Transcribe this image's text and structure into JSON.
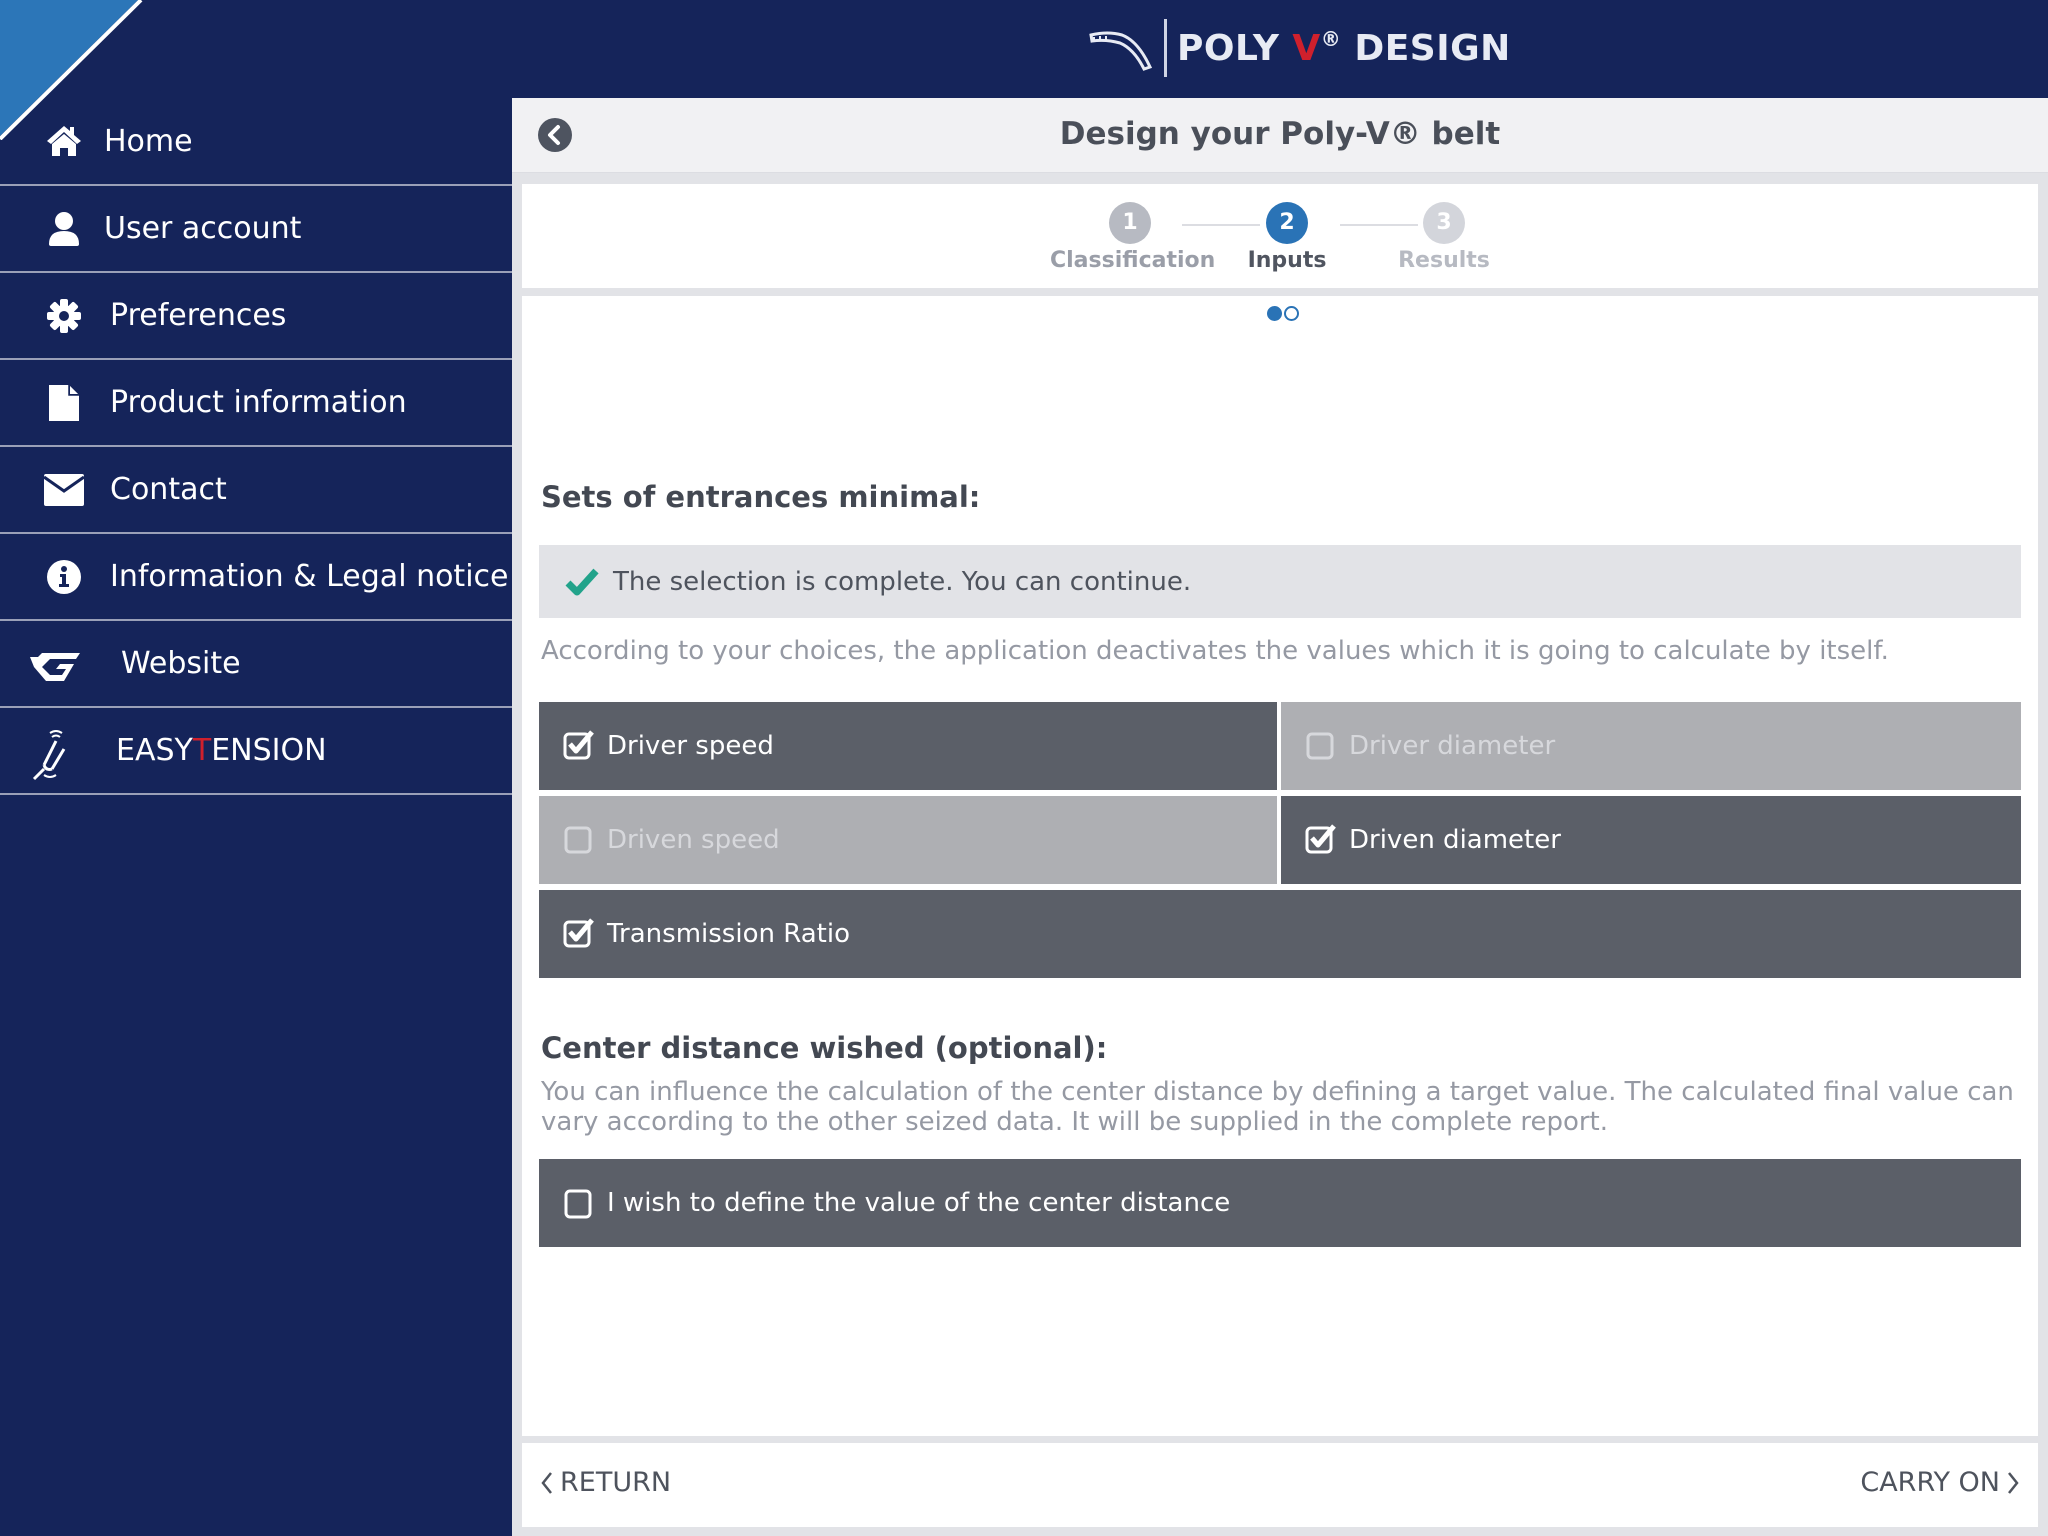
{
  "header": {
    "brand_prefix": "POLY ",
    "brand_v": "V",
    "brand_reg": "®",
    "brand_suffix": " DESIGN",
    "logo_icon": "belt-logo-icon"
  },
  "sidebar": {
    "items": [
      {
        "label": "Home",
        "icon": "home-icon"
      },
      {
        "label": "User account",
        "icon": "user-icon"
      },
      {
        "label": "Preferences",
        "icon": "gear-icon"
      },
      {
        "label": "Product information",
        "icon": "document-icon"
      },
      {
        "label": "Contact",
        "icon": "envelope-icon"
      },
      {
        "label": "Information & Legal notice",
        "icon": "info-icon"
      },
      {
        "label": "Website",
        "icon": "gates-logo-icon"
      },
      {
        "label_part1": "EASY",
        "label_red": "T",
        "label_part2": "ENSION",
        "icon": "tension-tool-icon"
      }
    ]
  },
  "titlebar": {
    "title": "Design your Poly-V® belt",
    "back_icon": "chevron-left-circle-icon"
  },
  "stepper": {
    "steps": [
      {
        "number": "1",
        "label": "Classification",
        "state": "done"
      },
      {
        "number": "2",
        "label": "Inputs",
        "state": "active"
      },
      {
        "number": "3",
        "label": "Results",
        "state": "todo"
      }
    ]
  },
  "pager": {
    "pages": 2,
    "current": 1
  },
  "entrances": {
    "title": "Sets of entrances minimal:",
    "status": "The selection is complete. You can continue.",
    "status_color": "#22a38b",
    "hint": "According to your choices, the application deactivates the values which it is going to calculate by itself.",
    "options": [
      {
        "label": "Driver speed",
        "checked": true,
        "enabled": true
      },
      {
        "label": "Driver diameter",
        "checked": false,
        "enabled": false
      },
      {
        "label": "Driven speed",
        "checked": false,
        "enabled": false
      },
      {
        "label": "Driven diameter",
        "checked": true,
        "enabled": true
      },
      {
        "label": "Transmission Ratio",
        "checked": true,
        "enabled": true
      }
    ]
  },
  "center_distance": {
    "title": "Center distance wished (optional):",
    "description": "You can influence the calculation of the center distance by defining a target value. The calculated final value can vary according to the other seized data. It will be supplied in the complete report.",
    "option_label": "I wish to define the value of the center distance",
    "option_checked": false
  },
  "footer": {
    "return_label": "RETURN",
    "carry_on_label": "CARRY ON"
  },
  "colors": {
    "navy": "#15245a",
    "accent_blue": "#2a73b6",
    "brand_red": "#d0202c",
    "option_on": "#5b5f68",
    "option_off": "#aeafb3"
  }
}
